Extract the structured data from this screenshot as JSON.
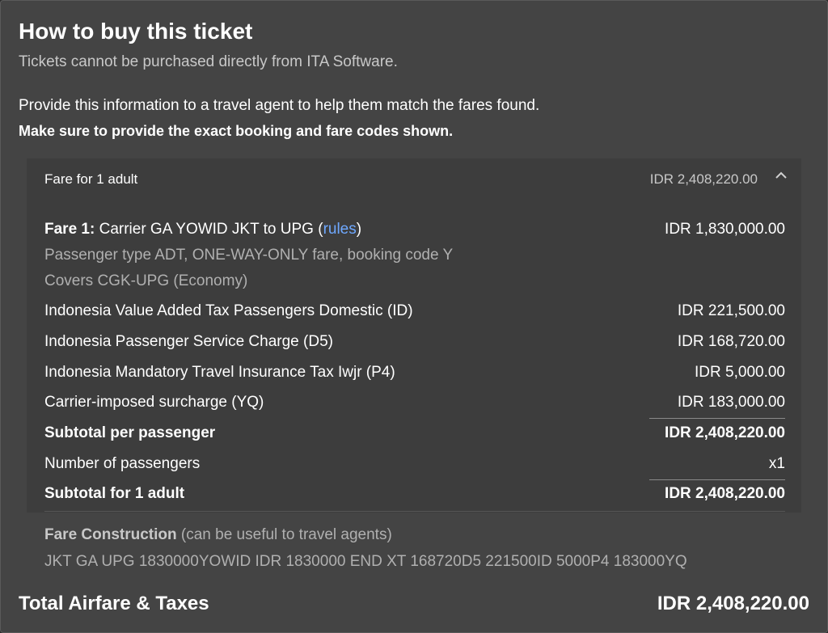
{
  "dialog": {
    "title": "How to buy this ticket",
    "subtitle": "Tickets cannot be purchased directly from ITA Software.",
    "info": "Provide this information to a travel agent to help them match the fares found.",
    "info_bold": "Make sure to provide the exact booking and fare codes shown."
  },
  "fare_header": {
    "label": "Fare for 1 adult",
    "amount": "IDR 2,408,220.00",
    "toggle_icon": "chevron-up-icon"
  },
  "fare1": {
    "prefix": "Fare 1:",
    "carrier_text": " Carrier GA YOWID JKT to UPG (",
    "rules_link": "rules",
    "suffix": ")",
    "amount": "IDR 1,830,000.00",
    "detail1": "Passenger type ADT, ONE-WAY-ONLY fare, booking code Y",
    "detail2": "Covers CGK-UPG (Economy)"
  },
  "taxes": [
    {
      "label": "Indonesia Value Added Tax Passengers Domestic (ID)",
      "amount": "IDR 221,500.00"
    },
    {
      "label": "Indonesia Passenger Service Charge (D5)",
      "amount": "IDR 168,720.00"
    },
    {
      "label": "Indonesia Mandatory Travel Insurance Tax Iwjr (P4)",
      "amount": "IDR 5,000.00"
    },
    {
      "label": "Carrier-imposed surcharge (YQ)",
      "amount": "IDR 183,000.00"
    }
  ],
  "subtotal_per_passenger": {
    "label": "Subtotal per passenger",
    "amount": "IDR 2,408,220.00"
  },
  "passengers": {
    "label": "Number of passengers",
    "value": "x1"
  },
  "subtotal_adult": {
    "label": "Subtotal for 1 adult",
    "amount": "IDR 2,408,220.00"
  },
  "fare_construction": {
    "label": "Fare Construction",
    "note": " (can be useful to travel agents)",
    "value": "JKT GA UPG 1830000YOWID IDR 1830000 END XT 168720D5 221500ID 5000P4 183000YQ"
  },
  "total": {
    "label": "Total Airfare & Taxes",
    "amount": "IDR 2,408,220.00"
  },
  "colors": {
    "link": "#6ea8ff",
    "background": "#444444",
    "panel": "#3d3d3d"
  }
}
